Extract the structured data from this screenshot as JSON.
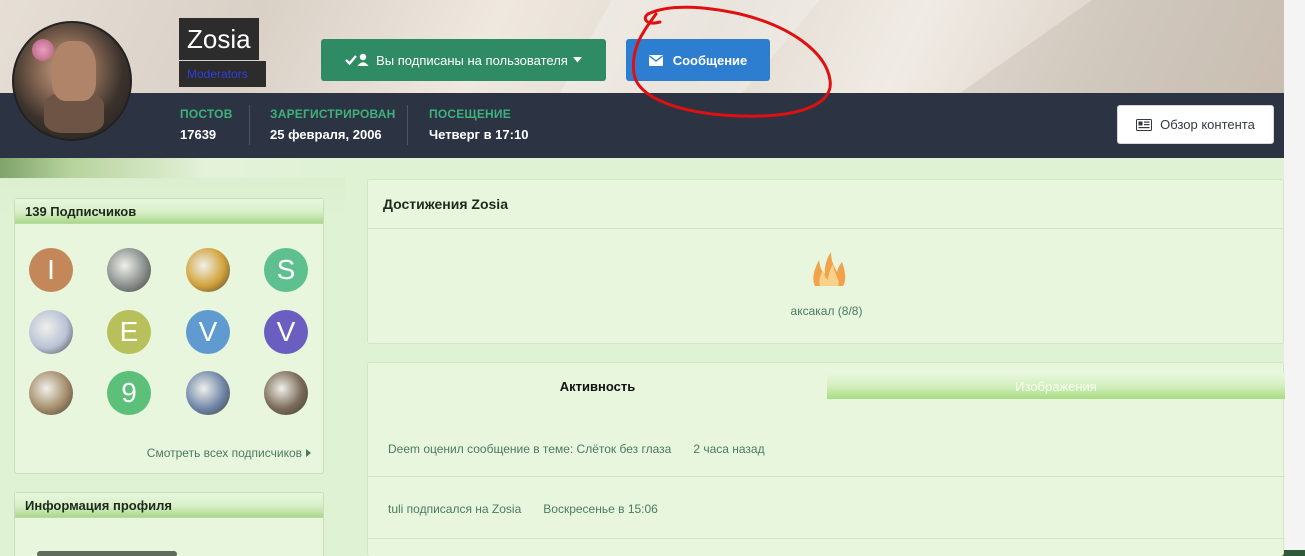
{
  "profile": {
    "username": "Zosia",
    "usergroup": "Moderators",
    "subscribed_label": "Вы подписаны на пользователя",
    "message_label": "Сообщение",
    "overview_label": "Обзор контента",
    "stats": [
      {
        "label": "ПОСТОВ",
        "value": "17639"
      },
      {
        "label": "ЗАРЕГИСТРИРОВАН",
        "value": "25 февраля, 2006"
      },
      {
        "label": "ПОСЕЩЕНИЕ",
        "value": "Четверг в 17:10"
      }
    ]
  },
  "followers": {
    "title": "139 Подписчиков",
    "see_all": "Смотреть всех подписчиков",
    "items": [
      {
        "letter": "I",
        "color": "#c4875a"
      },
      {
        "letter": "",
        "color": "#8a8f8c"
      },
      {
        "letter": "",
        "color": "#d2a23a"
      },
      {
        "letter": "S",
        "color": "#5fc08f"
      },
      {
        "letter": "",
        "color": "#b9c2d6"
      },
      {
        "letter": "E",
        "color": "#b7c05a"
      },
      {
        "letter": "V",
        "color": "#5f9bd0"
      },
      {
        "letter": "V",
        "color": "#6a5ec0"
      },
      {
        "letter": "",
        "color": "#a58d6a"
      },
      {
        "letter": "9",
        "color": "#5cc07a"
      },
      {
        "letter": "",
        "color": "#6f86a8"
      },
      {
        "letter": "",
        "color": "#7a6a58"
      }
    ]
  },
  "profile_info": {
    "title": "Информация профиля"
  },
  "achievements": {
    "title": "Достижения Zosia",
    "badge_label": "аксакал (8/8)"
  },
  "activity": {
    "tabs": [
      "Активность",
      "Изображения"
    ],
    "rows": [
      {
        "text": "Deem оценил сообщение в теме: Слёток без глаза",
        "when": "2 часа назад"
      },
      {
        "text": "tuli подписался на Zosia",
        "when": "Воскресенье в 15:06"
      }
    ]
  }
}
